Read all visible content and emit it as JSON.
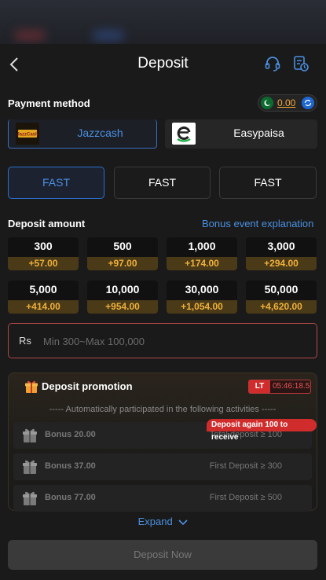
{
  "header": {
    "title": "Deposit",
    "icons": [
      "back-icon",
      "headset-icon",
      "history-icon"
    ]
  },
  "payment": {
    "label": "Payment method",
    "balance": "0.00",
    "methods": [
      {
        "name": "Jazzcash",
        "logo_text": "JazzCash",
        "active": true
      },
      {
        "name": "Easypaisa",
        "active": false
      }
    ],
    "channels": [
      "FAST",
      "FAST",
      "FAST"
    ]
  },
  "deposit": {
    "label": "Deposit amount",
    "bonus_link": "Bonus event explanation",
    "amounts": [
      {
        "value": "300",
        "bonus": "+57.00"
      },
      {
        "value": "500",
        "bonus": "+97.00"
      },
      {
        "value": "1,000",
        "bonus": "+174.00"
      },
      {
        "value": "3,000",
        "bonus": "+294.00"
      },
      {
        "value": "5,000",
        "bonus": "+414.00"
      },
      {
        "value": "10,000",
        "bonus": "+954.00"
      },
      {
        "value": "30,000",
        "bonus": "+1,054.00"
      },
      {
        "value": "50,000",
        "bonus": "+4,620.00"
      }
    ],
    "currency": "Rs",
    "placeholder": "Min 300~Max 100,000"
  },
  "promotion": {
    "title": "Deposit promotion",
    "lt_label": "LT",
    "timer": "05:46:18.5",
    "note": "----- Automatically participated in the following activities -----",
    "again_badge": "Deposit again 100 to receive",
    "rows": [
      {
        "bonus": "Bonus 20.00",
        "condition": "Total deposit ≥ 100"
      },
      {
        "bonus": "Bonus 37.00",
        "condition": "First Deposit ≥ 300"
      },
      {
        "bonus": "Bonus 77.00",
        "condition": "First Deposit ≥ 500"
      }
    ],
    "expand": "Expand"
  },
  "actions": {
    "deposit_now": "Deposit Now"
  },
  "colors": {
    "accent": "#4a90e2",
    "gold": "#f0b03a",
    "danger": "#d12c2c"
  }
}
